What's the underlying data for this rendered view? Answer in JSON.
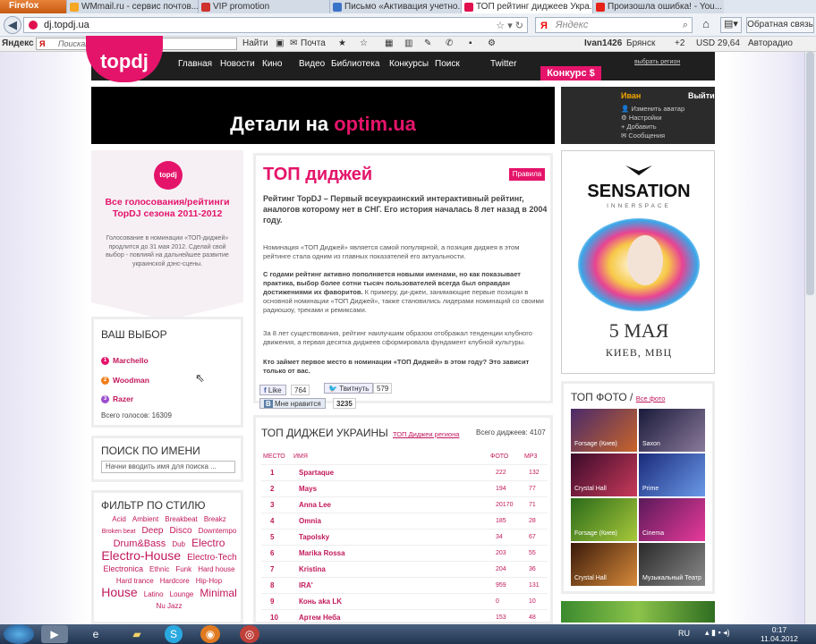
{
  "browser": {
    "app_button": "Firefox",
    "tabs": [
      {
        "label": "WMmail.ru - сервис почтов...",
        "icon_color": "#f5a623"
      },
      {
        "label": "VIP promotion",
        "icon_color": "#d0312d"
      },
      {
        "label": "Письмо «Активация учетно...",
        "icon_color": "#3b73c8"
      },
      {
        "label": "ТОП рейтинг диджеев Укра...",
        "icon_color": "#e0104f"
      },
      {
        "label": "Произошла ошибка! - You...",
        "icon_color": "#e62117"
      }
    ],
    "url": "dj.topdj.ua",
    "search_engine": "Яндекс",
    "search_placeholder": "Яндекс",
    "feedback_button": "Обратная связь"
  },
  "yandex_bar": {
    "brand": "Яндекс",
    "search_placeholder": "Поискать в Яндексе",
    "find_button": "Найти",
    "mail_label": "Почта",
    "user": "Ivan1426",
    "city": "Брянск",
    "weather": "+2",
    "currency": "USD 29,64",
    "radio": "Авторадио"
  },
  "site": {
    "logo": "topdj",
    "nav": [
      "Главная",
      "Новости",
      "Кино",
      "Видео",
      "Библиотека",
      "Конкурсы",
      "Поиск",
      "Twitter"
    ],
    "contest_button": "Конкурс $",
    "region_link": "выбрать регион",
    "banner": {
      "text_prefix": "Детали на ",
      "text_highlight": "optim.ua"
    },
    "user": {
      "name": "Иван",
      "logout": "Выйти",
      "links": [
        "Изменить аватар",
        "Настройки",
        "Добавить",
        "Сообщения"
      ]
    },
    "promo": {
      "logo": "topdj",
      "title": "Все голосования/рейтинги TopDJ сезона 2011-2012",
      "text": "Голосование в номинации «ТОП-диджей» продлится до 31 мая 2012. Сделай свой выбор - повлияй на дальнейшее развитие украинской дэнс-сцены."
    },
    "your_choice": {
      "title": "ВАШ ВЫБОР",
      "items": [
        {
          "num": "1",
          "name": "Marchello",
          "color": "#e4146a"
        },
        {
          "num": "2",
          "name": "Woodman",
          "color": "#f07f1b"
        },
        {
          "num": "3",
          "name": "Razer",
          "color": "#9c4dcc"
        }
      ],
      "total": "Всего голосов: 16309"
    },
    "name_search": {
      "title": "ПОИСК ПО ИМЕНИ",
      "placeholder": "Начни вводить имя для поиска ..."
    },
    "style_filter": {
      "title": "ФИЛЬТР ПО СТИЛЮ",
      "tags": [
        {
          "t": "Acid",
          "s": 8
        },
        {
          "t": "Ambient",
          "s": 8
        },
        {
          "t": "Breakbeat",
          "s": 8
        },
        {
          "t": "Breakz",
          "s": 8
        },
        {
          "t": "Broken beat",
          "s": 7
        },
        {
          "t": "Deep",
          "s": 10
        },
        {
          "t": "Disco",
          "s": 10
        },
        {
          "t": "Downtempo",
          "s": 8
        },
        {
          "t": "Drum&Bass",
          "s": 11
        },
        {
          "t": "Dub",
          "s": 8
        },
        {
          "t": "Electro",
          "s": 12
        },
        {
          "t": "Electro-House",
          "s": 14
        },
        {
          "t": "Electro-Tech",
          "s": 10
        },
        {
          "t": "Electronica",
          "s": 9
        },
        {
          "t": "Ethnic",
          "s": 8
        },
        {
          "t": "Funk",
          "s": 8
        },
        {
          "t": "Hard house",
          "s": 8
        },
        {
          "t": "Hard trance",
          "s": 8
        },
        {
          "t": "Hardcore",
          "s": 8
        },
        {
          "t": "Hip-Hop",
          "s": 8
        },
        {
          "t": "House",
          "s": 14
        },
        {
          "t": "Latino",
          "s": 8
        },
        {
          "t": "Lounge",
          "s": 8
        },
        {
          "t": "Minimal",
          "s": 12
        },
        {
          "t": "Nu Jazz",
          "s": 8
        }
      ]
    },
    "main": {
      "title": "ТОП диджей",
      "rules_button": "Правила",
      "lead": "Рейтинг TopDJ – Первый всеукраинский интерактивный рейтинг, аналогов которому нет в СНГ. Его история началась 8 лет назад в 2004 году.",
      "p1": "Номинация «ТОП Диджей» является самой популярной, а позиция диджея в этом рейтинге стала одним из главных показателей его актуальности.",
      "p2_bold": "С годами рейтинг активно пополняется новыми именами, но как показывает практика, выбор более сотни тысяч пользователей всегда был оправдан достижениями их фаворитов.",
      "p2_rest": " К примеру, ди-джеи, занимающие первые позиции в основной номинации «ТОП Диджей», также становились лидерами номинаций со своими радиошоу, треками и ремиксами.",
      "p3": "За 8 лет существования, рейтинг наилучшим образом отображал тенденции клубного движения, а первая десятка диджеев сформировала фундамент клубной культуры.",
      "p4": "Кто займет первое место в номинации «ТОП Диджей» в этом году? Это зависит только от вас.",
      "like_label": "Like",
      "like_count": "764",
      "tweet_label": "Твитнуть",
      "tweet_count": "579",
      "vk_label": "Мне нравится",
      "vk_count": "3235"
    },
    "rating": {
      "title": "ТОП ДИДЖЕИ УКРАИНЫ",
      "region_link": "ТОП Диджеи региона",
      "total": "Всего диджеев: 4107",
      "headers": {
        "place": "МЕСТО",
        "name": "ИМЯ",
        "photo": "ФОТО",
        "mp3": "MP3"
      },
      "rows": [
        {
          "n": "1",
          "name": "Spartaque",
          "photo": "222",
          "mp3": "132"
        },
        {
          "n": "2",
          "name": "Mays",
          "photo": "194",
          "mp3": "77"
        },
        {
          "n": "3",
          "name": "Anna Lee",
          "photo": "20170",
          "mp3": "71"
        },
        {
          "n": "4",
          "name": "Omnia",
          "photo": "185",
          "mp3": "28"
        },
        {
          "n": "5",
          "name": "Tapolsky",
          "photo": "34",
          "mp3": "67"
        },
        {
          "n": "6",
          "name": "Marika Rossa",
          "photo": "203",
          "mp3": "55"
        },
        {
          "n": "7",
          "name": "Kristina",
          "photo": "204",
          "mp3": "36"
        },
        {
          "n": "8",
          "name": "IRA'",
          "photo": "959",
          "mp3": "131"
        },
        {
          "n": "9",
          "name": "Конь aka LK",
          "photo": "0",
          "mp3": "10"
        },
        {
          "n": "10",
          "name": "Артем Неба",
          "photo": "153",
          "mp3": "48"
        }
      ]
    },
    "sensation": {
      "name": "SENSATION",
      "sub": "INNERSPACE",
      "date": "5 МАЯ",
      "city": "КИЕВ, МВЦ"
    },
    "top_photo": {
      "title": "ТОП ФОТО",
      "all_link": "Все фото",
      "items": [
        {
          "label": "Forsage (Киев)",
          "c1": "#4a2a6a",
          "c2": "#c8652a"
        },
        {
          "label": "Saxon",
          "c1": "#1a1a3a",
          "c2": "#8a7a9a"
        },
        {
          "label": "Crystal Hall",
          "c1": "#3a0a2a",
          "c2": "#c83a5a"
        },
        {
          "label": "Prime",
          "c1": "#1a2a7a",
          "c2": "#6a9ae8"
        },
        {
          "label": "Forsage (Киев)",
          "c1": "#2a6a1a",
          "c2": "#a8c83a"
        },
        {
          "label": "Cinema",
          "c1": "#5a1a5a",
          "c2": "#e83a9a"
        },
        {
          "label": "Crystal Hall",
          "c1": "#3a1a0a",
          "c2": "#d88a3a"
        },
        {
          "label": "Музыкальный Театр",
          "c1": "#2a2a2a",
          "c2": "#8a8a8a"
        }
      ]
    }
  },
  "taskbar": {
    "lang": "RU",
    "time": "0:17",
    "date": "11.04.2012"
  }
}
